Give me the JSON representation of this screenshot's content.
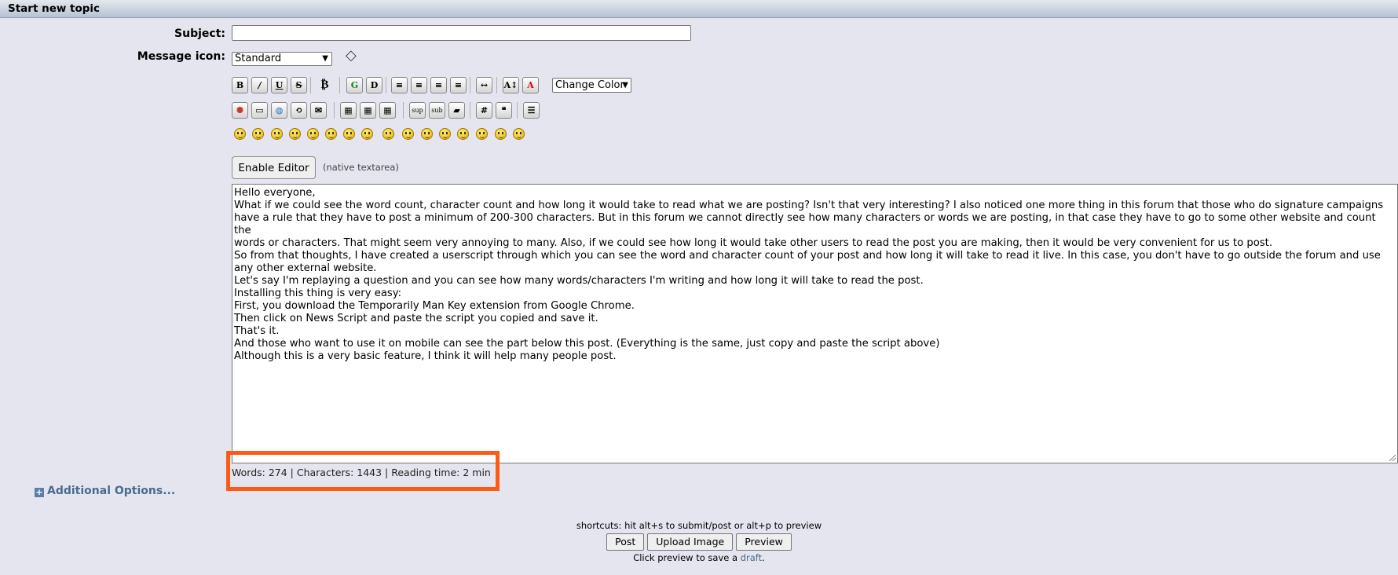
{
  "header": {
    "title": "Start new topic"
  },
  "form": {
    "subject_label": "Subject:",
    "subject_value": "",
    "message_icon_label": "Message icon:",
    "message_icon_selected": "Standard",
    "change_color_selected": "Change Color"
  },
  "toolbar_row1": [
    {
      "name": "bold-button",
      "glyph": "B"
    },
    {
      "name": "italic-button",
      "glyph": "/"
    },
    {
      "name": "underline-button",
      "glyph": "U"
    },
    {
      "name": "strikethrough-button",
      "glyph": "S"
    },
    {
      "name": "bitcoin-button",
      "glyph": "₿"
    },
    {
      "name": "glow-button",
      "glyph": "G"
    },
    {
      "name": "shadow-button",
      "glyph": "D"
    },
    {
      "name": "preformatted-button",
      "glyph": "≡"
    },
    {
      "name": "align-left-button",
      "glyph": "≡"
    },
    {
      "name": "align-center-button",
      "glyph": "≡"
    },
    {
      "name": "align-right-button",
      "glyph": "≡"
    },
    {
      "name": "horizontal-rule-button",
      "glyph": "↔"
    },
    {
      "name": "font-size-button",
      "glyph": "A↕"
    },
    {
      "name": "font-face-button",
      "glyph": "A"
    }
  ],
  "toolbar_row2": [
    {
      "name": "flash-button",
      "glyph": "✺"
    },
    {
      "name": "image-button",
      "glyph": "▭"
    },
    {
      "name": "url-button",
      "glyph": "◍"
    },
    {
      "name": "ftp-button",
      "glyph": "⟲"
    },
    {
      "name": "email-button",
      "glyph": "✉"
    },
    {
      "name": "table-button",
      "glyph": "▦"
    },
    {
      "name": "table-row-button",
      "glyph": "▦"
    },
    {
      "name": "table-column-button",
      "glyph": "▦"
    },
    {
      "name": "superscript-button",
      "glyph": "sup"
    },
    {
      "name": "subscript-button",
      "glyph": "sub"
    },
    {
      "name": "teletype-button",
      "glyph": "▰"
    },
    {
      "name": "code-button",
      "glyph": "#"
    },
    {
      "name": "quote-button",
      "glyph": "❝"
    },
    {
      "name": "list-button",
      "glyph": "☰"
    }
  ],
  "enable_editor_label": "Enable Editor",
  "native_note": "(native textarea)",
  "message_lines": [
    "Hello everyone,",
    "What if we could see the word count, character count and how long it would take to read what we are posting? Isn't that very interesting? I also noticed one more thing in this forum that those who do signature campaigns",
    "have a rule that they have to post a minimum of 200-300 characters. But in this forum we cannot directly see how many characters or words we are posting, in that case they have to go to some other website and count the",
    "words or characters. That might seem very annoying to many. Also, if we could see how long it would take other users to read the post you are making, then it would be very convenient for us to post.",
    "So from that thoughts, I have created a userscript through which you can see the word and character count of your post and how long it will take to read it live. In this case, you don't have to go outside the forum and use",
    "any other external website.",
    "Let's say I'm replaying a question and you can see how many words/characters I'm writing and how long it will take to read the post.",
    "Installing this thing is very easy:",
    "First, you download the Temporarily Man Key extension from Google Chrome.",
    "Then click on News Script and paste the script you copied and save it.",
    "That's it.",
    "And those who want to use it on mobile can see the part below this post. (Everything is the same, just copy and paste the script above)",
    "Although this is a very basic feature, I think it will help many people post."
  ],
  "counter_text": "Words: 274 | Characters: 1443 | Reading time: 2 min",
  "additional_options_label": "Additional Options...",
  "shortcuts_text": "shortcuts: hit alt+s to submit/post or alt+p to preview",
  "buttons": {
    "post": "Post",
    "upload": "Upload Image",
    "preview": "Preview"
  },
  "draft_note": {
    "prefix": "Click preview to save a ",
    "link": "draft",
    "suffix": "."
  },
  "colors": {
    "highlight": "#ff5a14",
    "link": "#476c8e"
  }
}
